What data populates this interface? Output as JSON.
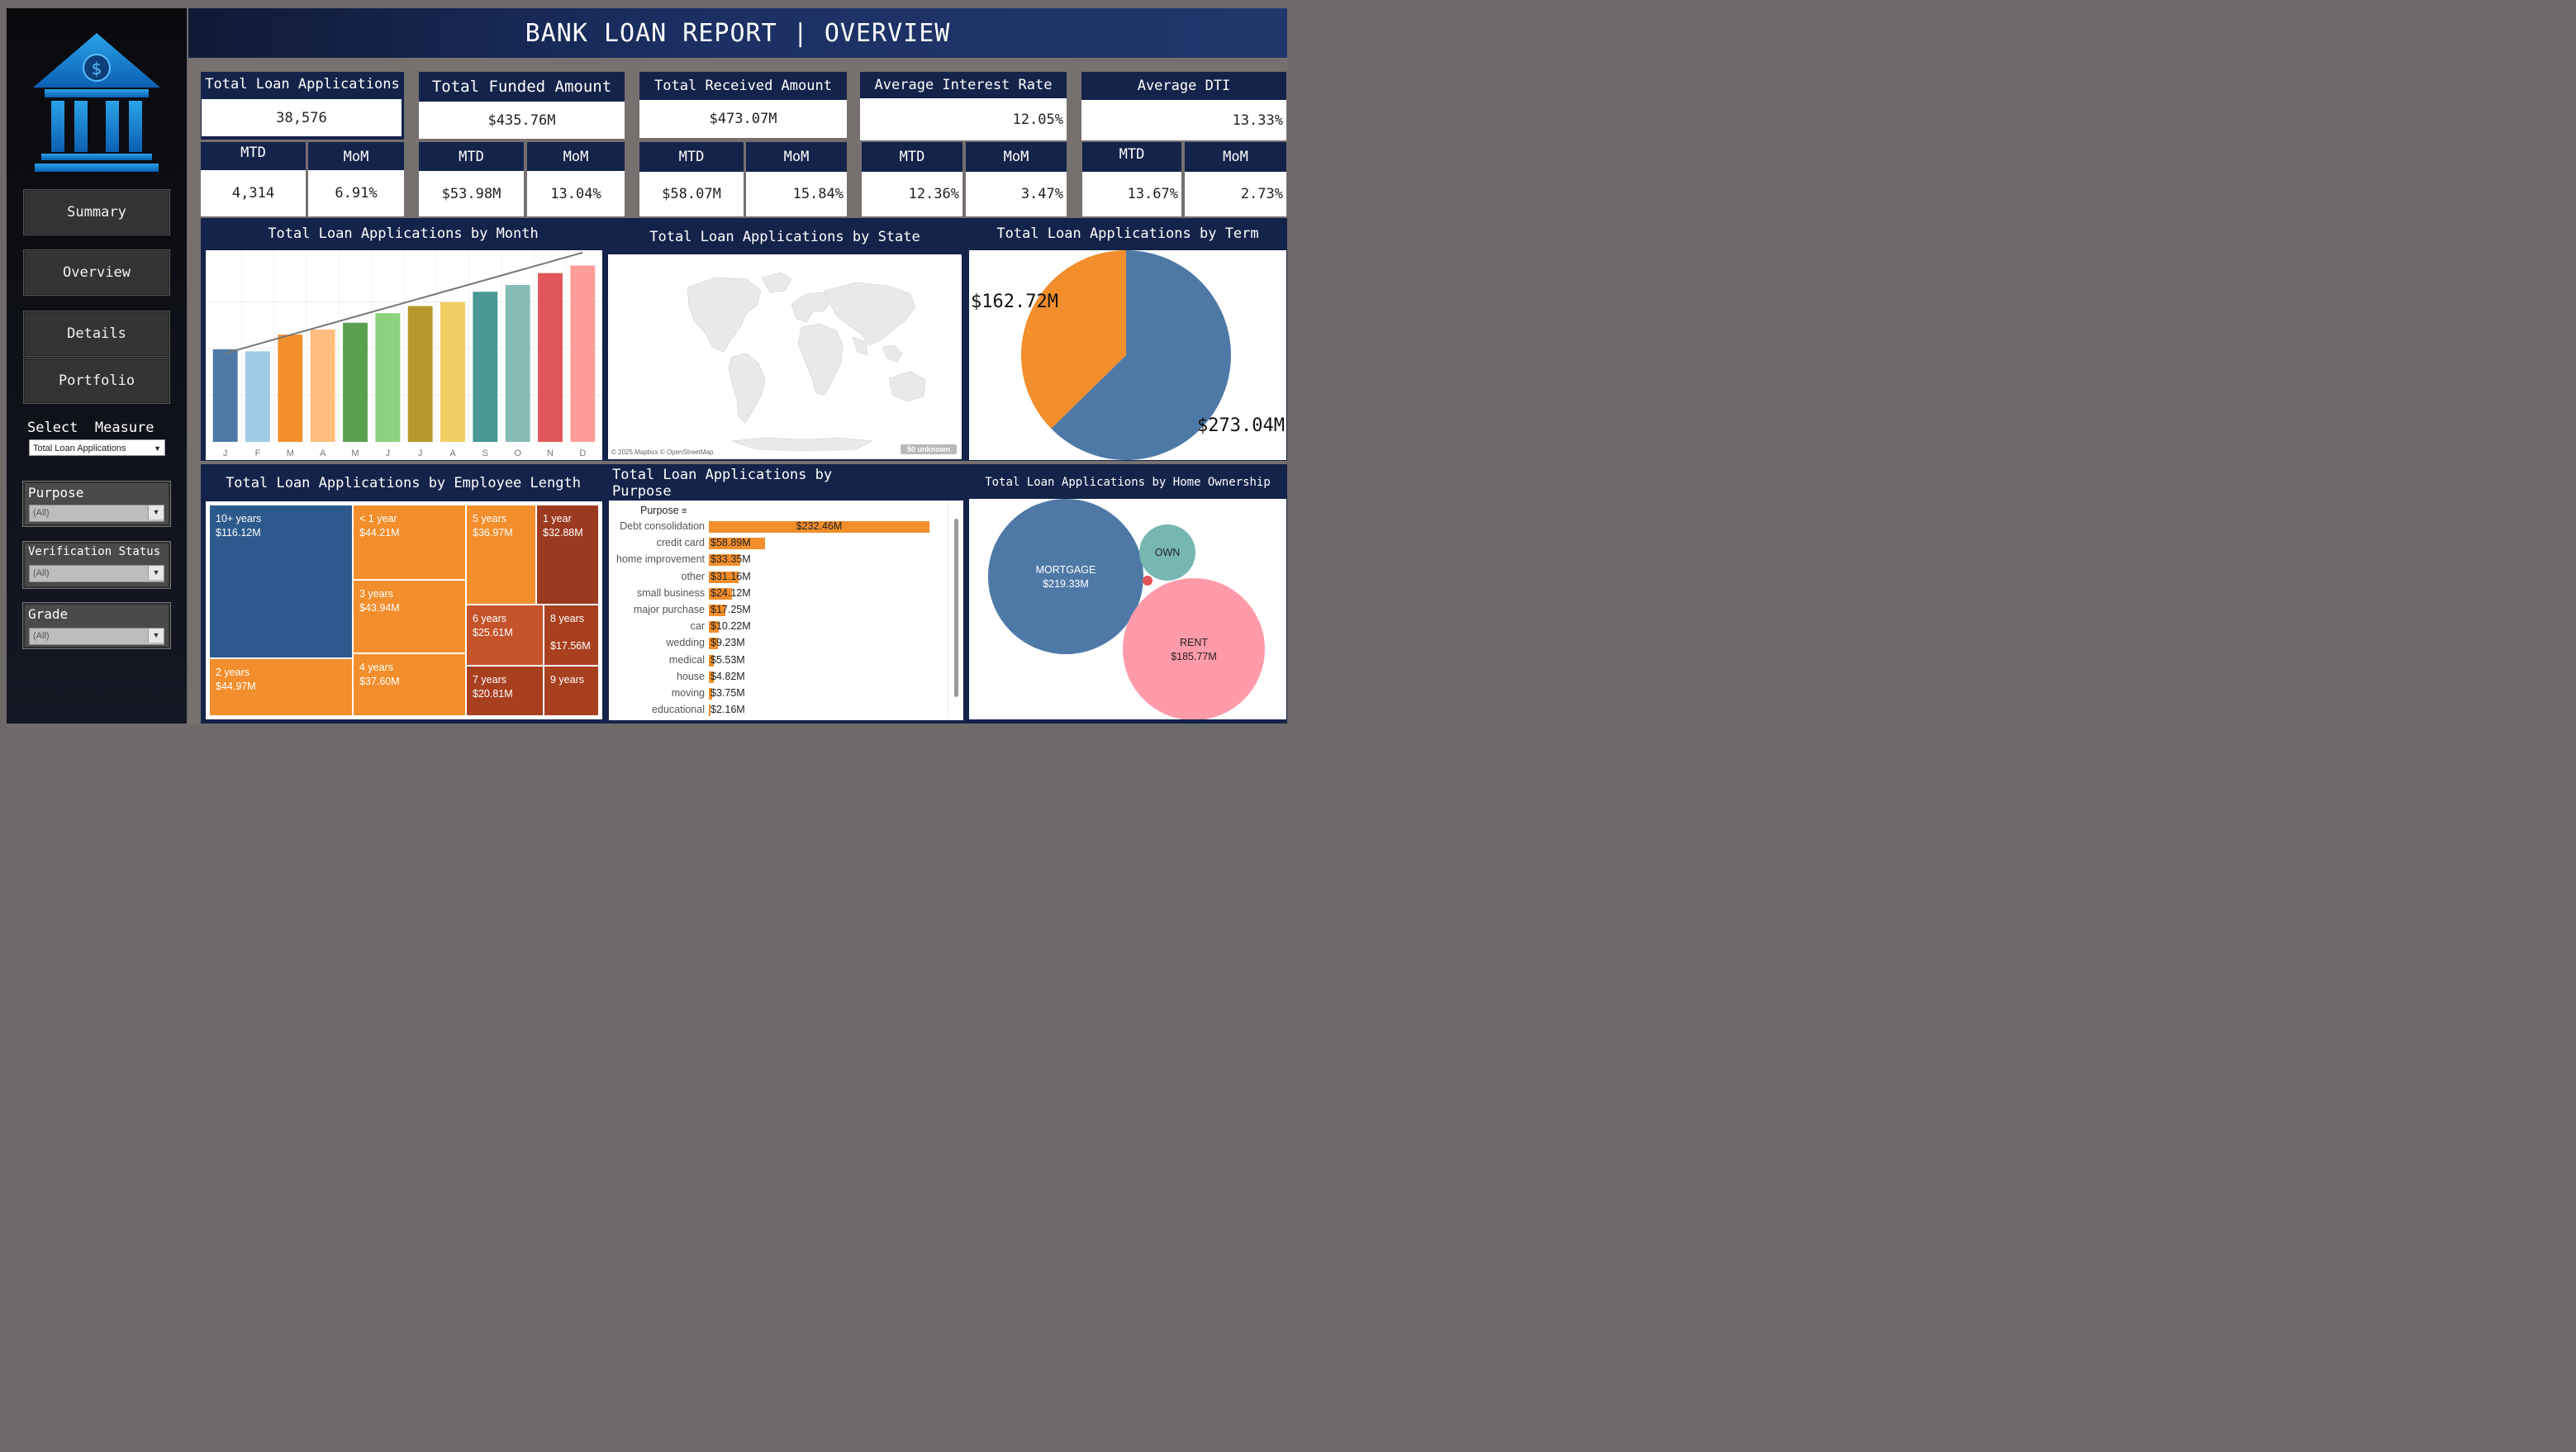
{
  "header": {
    "title": "BANK LOAN REPORT | OVERVIEW"
  },
  "sidebar": {
    "nav": [
      {
        "label": "Summary"
      },
      {
        "label": "Overview"
      },
      {
        "label": "Details"
      },
      {
        "label": "Portfolio"
      }
    ],
    "select_measure": {
      "label": "Select  Measure",
      "value": "Total Loan Applications"
    },
    "filters": [
      {
        "label": "Purpose",
        "value": "(All)"
      },
      {
        "label": "Verification Status",
        "value": "(All)"
      },
      {
        "label": "Grade",
        "value": "(All)"
      }
    ]
  },
  "kpis": [
    {
      "title": "Total Loan Applications",
      "value": "38,576",
      "mtd_label": "MTD",
      "mtd": "4,314",
      "mom_label": "MoM",
      "mom": "6.91%"
    },
    {
      "title": "Total Funded Amount",
      "value": "$435.76M",
      "mtd_label": "MTD",
      "mtd": "$53.98M",
      "mom_label": "MoM",
      "mom": "13.04%"
    },
    {
      "title": "Total Received Amount",
      "value": "$473.07M",
      "mtd_label": "MTD",
      "mtd": "$58.07M",
      "mom_label": "MoM",
      "mom": "15.84%"
    },
    {
      "title": "Average Interest Rate",
      "value": "12.05%",
      "mtd_label": "MTD",
      "mtd": "12.36%",
      "mom_label": "MoM",
      "mom": "3.47%"
    },
    {
      "title": "Average DTI",
      "value": "13.33%",
      "mtd_label": "MTD",
      "mtd": "13.67%",
      "mom_label": "MoM",
      "mom": "2.73%"
    }
  ],
  "panels": {
    "by_month": "Total Loan Applications by Month",
    "by_state": "Total Loan Applications by State",
    "by_term": "Total Loan Applications by Term",
    "by_emp": "Total Loan Applications by Employee Length",
    "by_purpose": "Total Loan Applications by Purpose",
    "by_home": "Total Loan Applications by Home Ownership"
  },
  "map": {
    "attribution": "© 2025 Mapbox © OpenStreetMap",
    "unknown_badge": "50 unknown"
  },
  "colors": {
    "navy": "#14234a",
    "accent_orange": "#f28e2b",
    "accent_blue": "#4e79a7"
  },
  "chart_data": [
    {
      "type": "bar",
      "title": "Total Loan Applications by Month",
      "categories": [
        "J",
        "F",
        "M",
        "A",
        "M",
        "J",
        "J",
        "A",
        "S",
        "O",
        "N",
        "D"
      ],
      "values": [
        2330,
        2280,
        2700,
        2830,
        3000,
        3240,
        3420,
        3520,
        3780,
        3950,
        4250,
        4440
      ],
      "ylim": [
        0,
        4700
      ],
      "colors": [
        "#4e79a7",
        "#a0cbe8",
        "#f28e2b",
        "#ffbe7d",
        "#59a14f",
        "#8cd17d",
        "#b6992d",
        "#f1ce63",
        "#499894",
        "#86bcb6",
        "#e15759",
        "#ff9d9a"
      ],
      "trendline": true,
      "grid": true
    },
    {
      "type": "pie",
      "title": "Total Loan Applications by Term",
      "labels": [
        "$273.04M",
        "$162.72M"
      ],
      "values": [
        273.04,
        162.72
      ],
      "colors": [
        "#4e79a7",
        "#f28e2b"
      ]
    },
    {
      "type": "heatmap",
      "title": "Total Loan Applications by Employee Length",
      "items": [
        {
          "name": "10+ years",
          "value": 116.12,
          "label": "$116.12M",
          "color": "#2c5a8c"
        },
        {
          "name": "2 years",
          "value": 44.97,
          "label": "$44.97M",
          "color": "#f28e2b"
        },
        {
          "name": "< 1 year",
          "value": 44.21,
          "label": "$44.21M",
          "color": "#f28e2b"
        },
        {
          "name": "3 years",
          "value": 43.94,
          "label": "$43.94M",
          "color": "#f28e2b"
        },
        {
          "name": "4 years",
          "value": 37.6,
          "label": "$37.60M",
          "color": "#f28e2b"
        },
        {
          "name": "5 years",
          "value": 36.97,
          "label": "$36.97M",
          "color": "#f28e2b"
        },
        {
          "name": "1 year",
          "value": 32.88,
          "label": "$32.88M",
          "color": "#9c3a20"
        },
        {
          "name": "6 years",
          "value": 25.61,
          "label": "$25.61M",
          "color": "#c4522a"
        },
        {
          "name": "8 years",
          "value": 17.56,
          "label": "$17.56M",
          "color": "#a8401f"
        },
        {
          "name": "7 years",
          "value": 20.81,
          "label": "$20.81M",
          "color": "#a8401f"
        },
        {
          "name": "9 years",
          "value": 0,
          "label": "",
          "color": "#a8401f"
        }
      ]
    },
    {
      "type": "bar",
      "title": "Total Loan Applications by Purpose",
      "header": "Purpose",
      "categories": [
        "Debt consolidation",
        "credit card",
        "home improvement",
        "other",
        "small business",
        "major purchase",
        "car",
        "wedding",
        "medical",
        "house",
        "moving",
        "educational"
      ],
      "values": [
        232.46,
        58.89,
        33.35,
        31.16,
        24.12,
        17.25,
        10.22,
        9.23,
        5.53,
        4.82,
        3.75,
        2.16
      ],
      "labels": [
        "$232.46M",
        "$58.89M",
        "$33.35M",
        "$31.16M",
        "$24.12M",
        "$17.25M",
        "$10.22M",
        "$9.23M",
        "$5.53M",
        "$4.82M",
        "$3.75M",
        "$2.16M"
      ],
      "xlim": [
        0,
        240
      ],
      "color": "#f28e2b"
    },
    {
      "type": "scatter",
      "title": "Total Loan Applications by Home Ownership",
      "bubbles": [
        {
          "name": "MORTGAGE",
          "value": 219.33,
          "label": "$219.33M",
          "color": "#4e79a7"
        },
        {
          "name": "RENT",
          "value": 185.77,
          "label": "$185.77M",
          "color": "#ff9aa8"
        },
        {
          "name": "OWN",
          "value": null,
          "label": "",
          "color": "#76b7b2"
        },
        {
          "name": "OTHER",
          "value": null,
          "label": "",
          "color": "#e15759"
        }
      ]
    }
  ]
}
